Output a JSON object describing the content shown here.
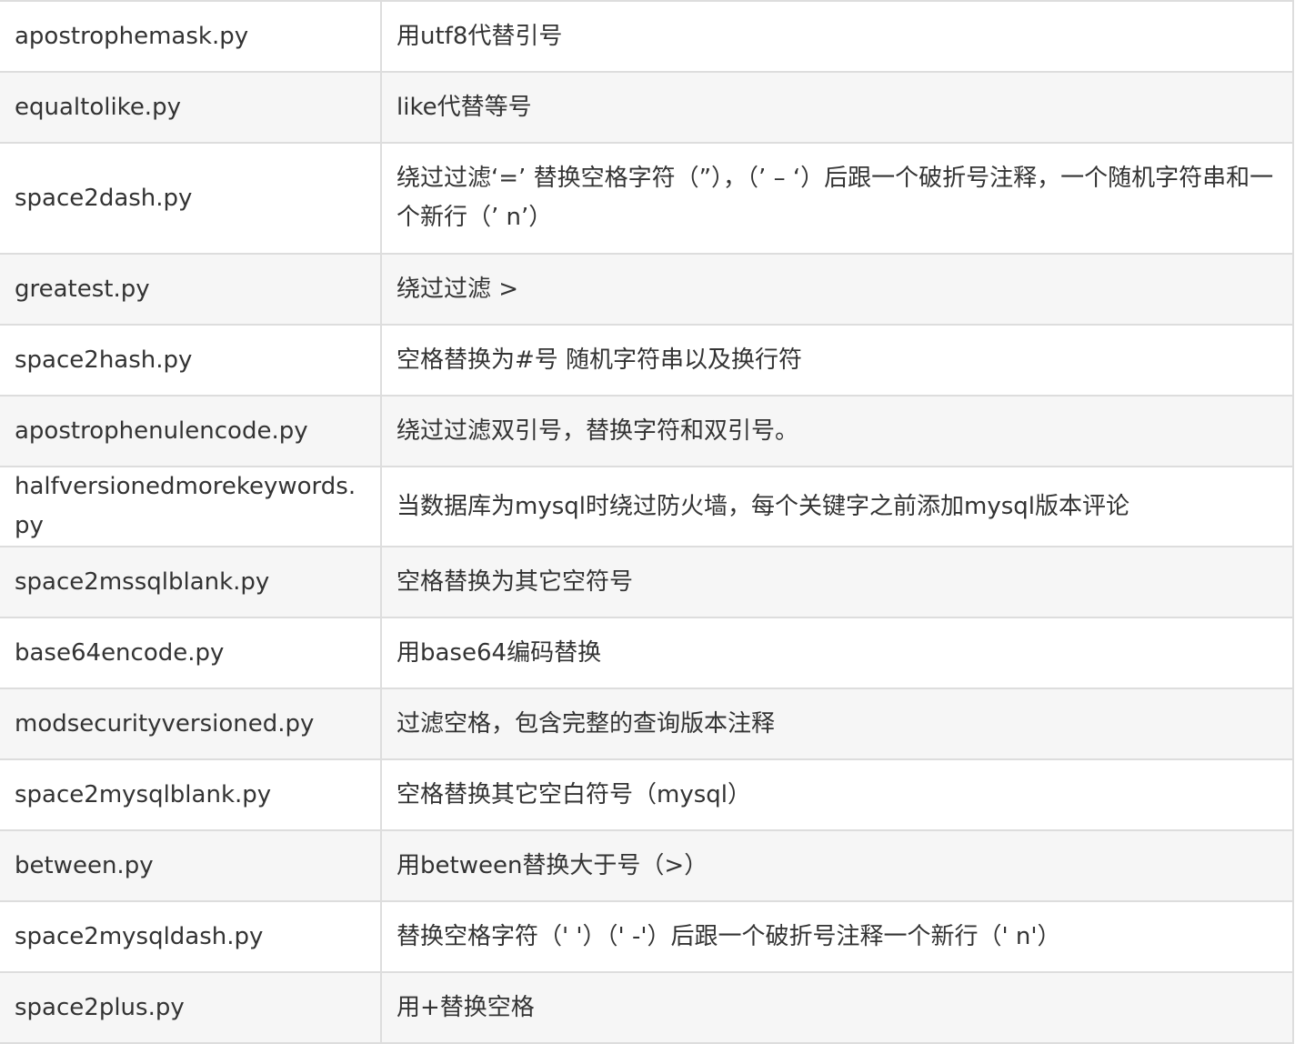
{
  "rows": [
    {
      "name": "apostrophemask.py",
      "desc": "用utf8代替引号"
    },
    {
      "name": "equaltolike.py",
      "desc": "like代替等号"
    },
    {
      "name": "space2dash.py",
      "desc": "绕过过滤‘=’ 替换空格字符（”），（’ – ‘）后跟一个破折号注释，一个随机字符串和一个新行（’ n’）"
    },
    {
      "name": "greatest.py",
      "desc": "绕过过滤 >"
    },
    {
      "name": "space2hash.py",
      "desc": "空格替换为#号 随机字符串以及换行符"
    },
    {
      "name": "apostrophenulencode.py",
      "desc": "绕过过滤双引号，替换字符和双引号。"
    },
    {
      "name": "halfversionedmorekeywords.py",
      "desc": "当数据库为mysql时绕过防火墙，每个关键字之前添加mysql版本评论"
    },
    {
      "name": "space2mssqlblank.py",
      "desc": "空格替换为其它空符号"
    },
    {
      "name": "base64encode.py",
      "desc": "用base64编码替换"
    },
    {
      "name": "modsecurityversioned.py",
      "desc": "过滤空格，包含完整的查询版本注释"
    },
    {
      "name": "space2mysqlblank.py",
      "desc": "空格替换其它空白符号（mysql）"
    },
    {
      "name": "between.py",
      "desc": "用between替换大于号（>）"
    },
    {
      "name": "space2mysqldash.py",
      "desc": "替换空格字符（' '）（' -'）后跟一个破折号注释一个新行（' n'）"
    },
    {
      "name": "space2plus.py",
      "desc": "用+替换空格"
    }
  ]
}
